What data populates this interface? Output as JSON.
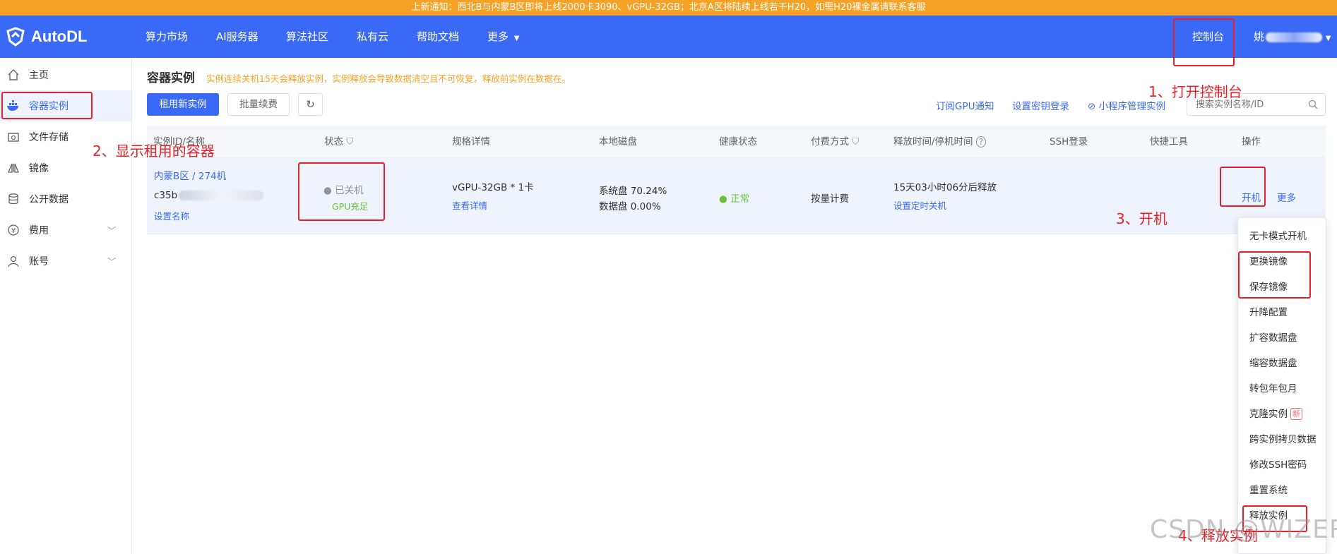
{
  "notice": "上新通知：西北B与内蒙B区即将上线2000卡3090、vGPU-32GB；北京A区将陆续上线若干H20，如需H20裸金属请联系客服",
  "brand": {
    "name": "AutoDL",
    "icon": "autodl-logo-icon"
  },
  "nav": {
    "items": [
      "算力市场",
      "AI服务器",
      "算法社区",
      "私有云",
      "帮助文档",
      "更多"
    ],
    "console": "控制台",
    "user": "姚"
  },
  "sidebar": {
    "items": [
      {
        "label": "主页",
        "icon": "home-icon"
      },
      {
        "label": "容器实例",
        "icon": "docker-icon"
      },
      {
        "label": "文件存储",
        "icon": "folder-icon"
      },
      {
        "label": "镜像",
        "icon": "image-icon"
      },
      {
        "label": "公开数据",
        "icon": "database-icon"
      },
      {
        "label": "费用",
        "icon": "yen-icon"
      },
      {
        "label": "账号",
        "icon": "user-icon"
      }
    ]
  },
  "page": {
    "title": "容器实例",
    "tip": "实例连续关机15天会释放实例，实例释放会导致数据清空且不可恢复，释放前实例在数据在。"
  },
  "toolbar": {
    "rent_new": "租用新实例",
    "batch_renew": "批量续费",
    "links": [
      "订阅GPU通知",
      "设置密钥登录",
      "小程序管理实例"
    ],
    "search_placeholder": "搜索实例名称/ID"
  },
  "table": {
    "headers": [
      "实例ID/名称",
      "状态",
      "规格详情",
      "本地磁盘",
      "健康状态",
      "付费方式",
      "释放时间/停机时间",
      "SSH登录",
      "快捷工具",
      "操作"
    ],
    "row": {
      "region": "内蒙B区 / 274机",
      "id": "c35b",
      "set_name": "设置名称",
      "status": "已关机",
      "gpu_status": "GPU充足",
      "spec": "vGPU-32GB * 1卡",
      "view_detail": "查看详情",
      "system_disk": "系统盘 70.24%",
      "data_disk": "数据盘 0.00%",
      "health": "正常",
      "billing": "按量计费",
      "release_time": "15天03小时06分后释放",
      "set_shutdown": "设置定时关机",
      "power_on": "开机",
      "more": "更多"
    }
  },
  "more_menu": [
    "无卡模式开机",
    "更换镜像",
    "保存镜像",
    "升降配置",
    "扩容数据盘",
    "缩容数据盘",
    "转包年包月",
    "克隆实例",
    "跨实例拷贝数据",
    "修改SSH密码",
    "重置系统",
    "释放实例"
  ],
  "new_badge": "新",
  "annotations": {
    "step1": "1、打开控制台",
    "step2": "2、显示租用的容器",
    "step3": "3、开机",
    "step4": "4、释放实例"
  },
  "watermark": "CSDN @WIZERS",
  "colors": {
    "accent": "#3a69f5",
    "notice": "#f5a227",
    "annotation": "#e8202a",
    "success": "#67c23a"
  }
}
